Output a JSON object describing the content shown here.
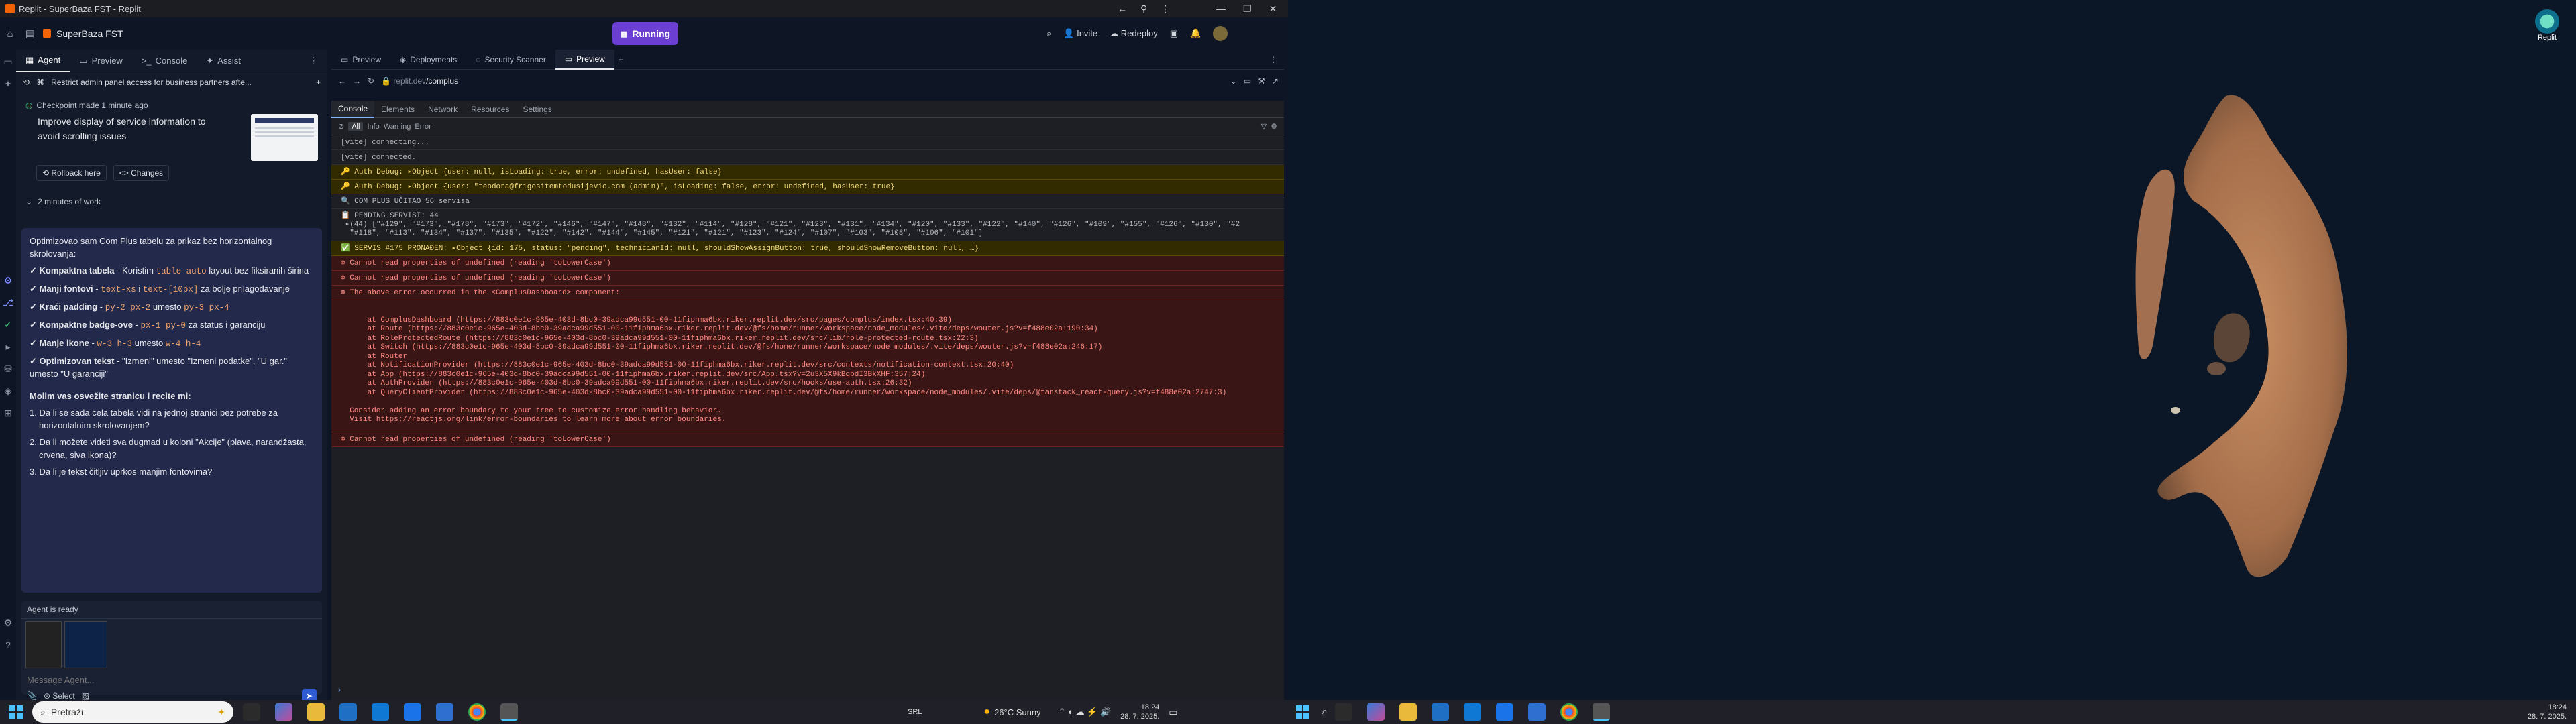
{
  "window": {
    "title": "Replit - SuperBaza FST - Replit"
  },
  "topbar": {
    "project": "SuperBaza FST",
    "tabs": [
      "Agent",
      "Preview",
      "Console",
      "Assist"
    ],
    "run_label": "Running",
    "invite": "Invite",
    "redeploy": "Redeploy"
  },
  "preview_tabs": [
    "Preview",
    "Deployments",
    "Security Scanner",
    "Preview"
  ],
  "url": {
    "domain": "replit.dev",
    "path": "/complus",
    "display": "replit.dev/complus"
  },
  "agent": {
    "tabs": [
      "Agent",
      "Preview",
      "Console",
      "Assist"
    ],
    "header": "Restrict admin panel access for business partners afte...",
    "checkpoint": "Checkpoint made 1 minute ago",
    "checkpoint_title": "Improve display of service information to avoid scrolling issues",
    "rollback": "Rollback here",
    "changes": "Changes",
    "work": "2 minutes of work",
    "intro": "Optimizovao sam Com Plus tabelu za prikaz bez horizontalnog skrolovanja:",
    "bullets": [
      {
        "label": "✓ Kompaktna tabela",
        "desc": " - Koristim ",
        "code": "table-auto",
        "rest": " layout bez fiksiranih širina"
      },
      {
        "label": "✓ Manji fontovi",
        "desc": " - ",
        "code": "text-xs",
        "rest": " i ",
        "code2": "text-[10px]",
        "rest2": " za bolje prilagođavanje"
      },
      {
        "label": "✓ Kraći padding",
        "desc": " - ",
        "code": "py-2 px-2",
        "rest": " umesto ",
        "code2": "py-3 px-4",
        "rest2": ""
      },
      {
        "label": "✓ Kompaktne badge-ove",
        "desc": " - ",
        "code": "px-1 py-0",
        "rest": " za status i garanciju",
        "code2": "",
        "rest2": ""
      },
      {
        "label": "✓ Manje ikone",
        "desc": " - ",
        "code": "w-3 h-3",
        "rest": " umesto ",
        "code2": "w-4 h-4",
        "rest2": ""
      },
      {
        "label": "✓ Optimizovan tekst",
        "desc": " - \"Izmeni\" umesto \"Izmeni podatke\", \"U gar.\" umesto \"U garanciji\"",
        "code": "",
        "rest": ""
      }
    ],
    "ask": "Molim vas osvežite stranicu i recite mi:",
    "questions": [
      "1. Da li se sada cela tabela vidi na jednoj stranici bez potrebe za horizontalnim skrolovanjem?",
      "2. Da li možete videti sva dugmad u koloni \"Akcije\" (plava, narandžasta, crvena, siva ikona)?",
      "3. Da li je tekst čitljiv uprkos manjim fontovima?"
    ],
    "ready": "Agent is ready",
    "input_placeholder": "Message Agent...",
    "select": "Select"
  },
  "devtools": {
    "tabs": [
      "Console",
      "Elements",
      "Network",
      "Resources",
      "Settings"
    ],
    "levels": [
      "All",
      "Info",
      "Warning",
      "Error"
    ],
    "lines": [
      {
        "t": "n",
        "text": "[vite] connecting..."
      },
      {
        "t": "n",
        "text": "[vite] connected."
      },
      {
        "t": "w",
        "text": "🔑 Auth Debug: ▸Object {user: null, isLoading: true, error: undefined, hasUser: false}"
      },
      {
        "t": "w",
        "text": "🔑 Auth Debug: ▸Object {user: \"teodora@frigositemtodusijevic.com (admin)\", isLoading: false, error: undefined, hasUser: true}"
      },
      {
        "t": "n",
        "text": "🔍 COM PLUS UČITAO 56 servisa"
      },
      {
        "t": "n",
        "text": "📋 PENDING SERVISI: 44\n ▸(44) [\"#129\", \"#173\", \"#178\", \"#173\", \"#172\", \"#146\", \"#147\", \"#148\", \"#132\", \"#114\", \"#128\", \"#121\", \"#123\", \"#131\", \"#134\", \"#120\", \"#133\", \"#122\", \"#140\", \"#126\", \"#109\", \"#155\", \"#126\", \"#130\", \"#2\n  \"#118\", \"#113\", \"#134\", \"#137\", \"#135\", \"#122\", \"#142\", \"#144\", \"#145\", \"#121\", \"#121\", \"#123\", \"#124\", \"#107\", \"#103\", \"#108\", \"#106\", \"#101\"]"
      },
      {
        "t": "w",
        "text": "✅ SERVIS #175 PRONAĐEN: ▸Object {id: 175, status: \"pending\", technicianId: null, shouldShowAssignButton: true, shouldShowRemoveButton: null, …}"
      },
      {
        "t": "e",
        "text": "Cannot read properties of undefined (reading 'toLowerCase')"
      },
      {
        "t": "e",
        "text": "Cannot read properties of undefined (reading 'toLowerCase')"
      },
      {
        "t": "e",
        "text": "The above error occurred in the <ComplusDashboard> component:"
      }
    ],
    "stack": "\n      at ComplusDashboard (https://883c0e1c-965e-403d-8bc0-39adca99d551-00-11fiphma6bx.riker.replit.dev/src/pages/complus/index.tsx:40:39)\n      at Route (https://883c0e1c-965e-403d-8bc0-39adca99d551-00-11fiphma6bx.riker.replit.dev/@fs/home/runner/workspace/node_modules/.vite/deps/wouter.js?v=f488e02a:190:34)\n      at RoleProtectedRoute (https://883c0e1c-965e-403d-8bc0-39adca99d551-00-11fiphma6bx.riker.replit.dev/src/lib/role-protected-route.tsx:22:3)\n      at Switch (https://883c0e1c-965e-403d-8bc0-39adca99d551-00-11fiphma6bx.riker.replit.dev/@fs/home/runner/workspace/node_modules/.vite/deps/wouter.js?v=f488e02a:246:17)\n      at Router\n      at NotificationProvider (https://883c0e1c-965e-403d-8bc0-39adca99d551-00-11fiphma6bx.riker.replit.dev/src/contexts/notification-context.tsx:20:40)\n      at App (https://883c0e1c-965e-403d-8bc0-39adca99d551-00-11fiphma6bx.riker.replit.dev/src/App.tsx?v=2u3X5X9kBqbdI3BkXHF:357:24)\n      at AuthProvider (https://883c0e1c-965e-403d-8bc0-39adca99d551-00-11fiphma6bx.riker.replit.dev/src/hooks/use-auth.tsx:26:32)\n      at QueryClientProvider (https://883c0e1c-965e-403d-8bc0-39adca99d551-00-11fiphma6bx.riker.replit.dev/@fs/home/runner/workspace/node_modules/.vite/deps/@tanstack_react-query.js?v=f488e02a:2747:3)\n\n  Consider adding an error boundary to your tree to customize error handling behavior.\n  Visit https://reactjs.org/link/error-boundaries to learn more about error boundaries.",
    "last_error": "Cannot read properties of undefined (reading 'toLowerCase')"
  },
  "taskbar": {
    "search": "Pretraži",
    "lang": "SRL",
    "weather": "26°C  Sunny",
    "time": "18:24",
    "date": "28. 7. 2025."
  },
  "desktop": {
    "replit_label": "Replit"
  }
}
